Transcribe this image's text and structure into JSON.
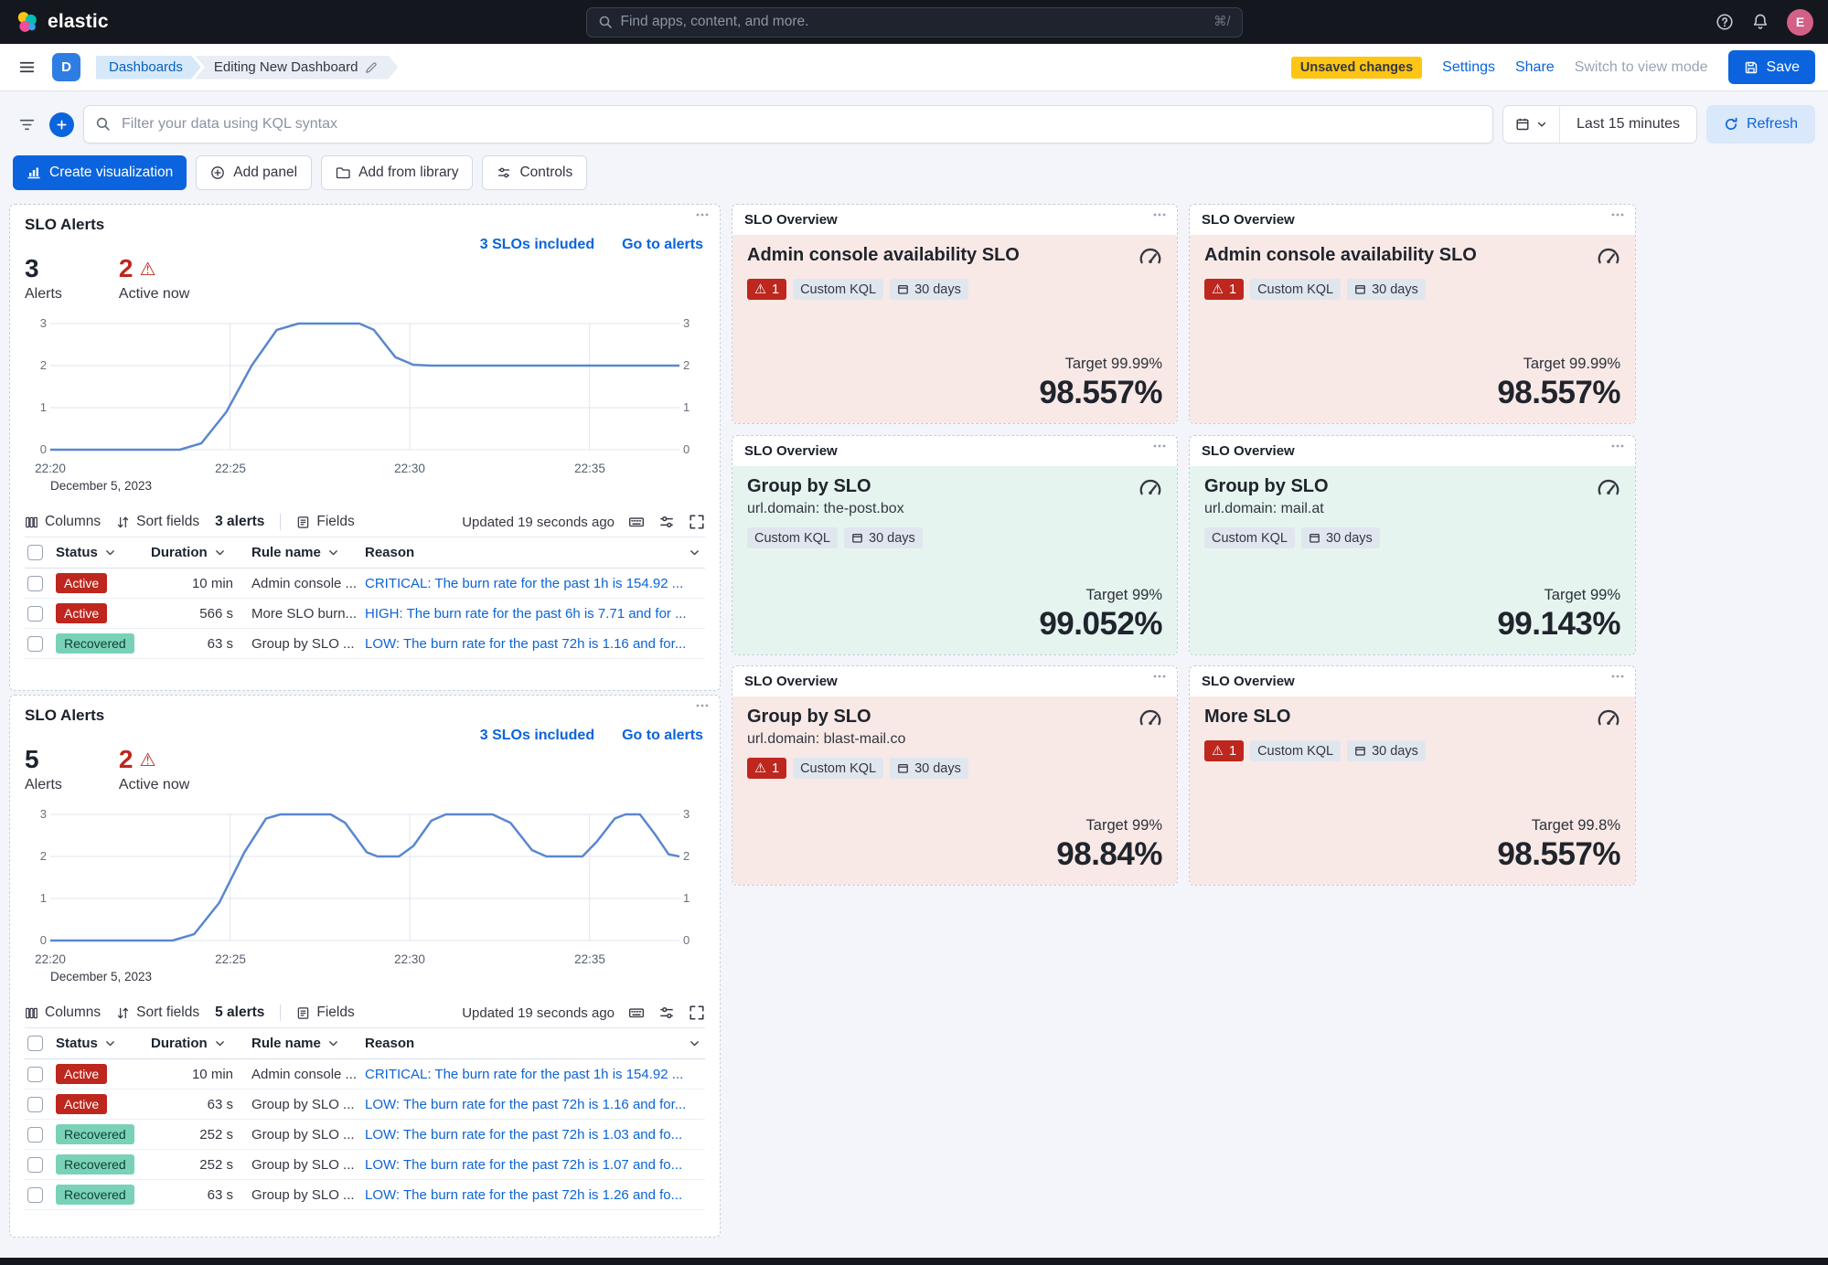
{
  "colors": {
    "primary": "#0b64dd",
    "danger": "#bd271e",
    "warning_badge": "#fec514",
    "success_badge": "#79d2b8",
    "tint_danger": "#f8e9e6",
    "tint_success": "#e5f4ef",
    "chart_line": "#5a87cf"
  },
  "icons": {
    "warning": "⚠"
  },
  "header": {
    "brand": "elastic",
    "search_placeholder": "Find apps, content, and more.",
    "search_shortcut": "⌘/",
    "avatar_initial": "E"
  },
  "toolbar": {
    "space_initial": "D",
    "breadcrumb_root": "Dashboards",
    "breadcrumb_current": "Editing New Dashboard",
    "unsaved_badge": "Unsaved changes",
    "settings_label": "Settings",
    "share_label": "Share",
    "view_mode_label": "Switch to view mode",
    "save_label": "Save"
  },
  "query_bar": {
    "kql_placeholder": "Filter your data using KQL syntax",
    "time_range": "Last 15 minutes",
    "refresh_label": "Refresh"
  },
  "edit_actions": {
    "create_visualization": "Create visualization",
    "add_panel": "Add panel",
    "add_from_library": "Add from library",
    "controls": "Controls"
  },
  "alerts_panels": [
    {
      "title": "SLO Alerts",
      "slos_included_link": "3 SLOs included",
      "go_to_alerts_link": "Go to alerts",
      "stats": [
        {
          "value": "3",
          "label": "Alerts"
        },
        {
          "value": "2",
          "label": "Active now"
        }
      ],
      "chart": {
        "type": "line",
        "line_color": "#5a87cf",
        "x_axis": {
          "t_max": 17.5,
          "ticks": [
            {
              "label": "22:20",
              "sub": "December 5, 2023",
              "t": 0
            },
            {
              "label": "22:25",
              "t": 5
            },
            {
              "label": "22:30",
              "t": 10
            },
            {
              "label": "22:35",
              "t": 15
            }
          ]
        },
        "y_axis": {
          "min": 0,
          "max": 3,
          "ticks": [
            0,
            1,
            2,
            3
          ]
        },
        "series": [
          {
            "name": "alerts",
            "points": [
              [
                0,
                0
              ],
              [
                3.6,
                0
              ],
              [
                4.2,
                0.15
              ],
              [
                4.9,
                0.9
              ],
              [
                5.6,
                2.0
              ],
              [
                6.3,
                2.85
              ],
              [
                6.9,
                3
              ],
              [
                8.6,
                3
              ],
              [
                9.0,
                2.85
              ],
              [
                9.6,
                2.2
              ],
              [
                10.1,
                2.02
              ],
              [
                10.6,
                2
              ],
              [
                17.5,
                2
              ]
            ]
          }
        ]
      },
      "grid_toolbar": {
        "columns": "Columns",
        "sort_fields": "Sort fields",
        "alert_count": "3 alerts",
        "fields": "Fields",
        "updated": "Updated 19 seconds ago"
      },
      "table": {
        "headers": [
          "Status",
          "Duration",
          "Rule name",
          "Reason"
        ],
        "rows": [
          {
            "status": "Active",
            "status_type": "active",
            "duration": "10 min",
            "rule_name": "Admin console ...",
            "reason": "CRITICAL: The burn rate for the past 1h is 154.92 ..."
          },
          {
            "status": "Active",
            "status_type": "active",
            "duration": "566 s",
            "rule_name": "More SLO burn...",
            "reason": "HIGH: The burn rate for the past 6h is 7.71 and for ..."
          },
          {
            "status": "Recovered",
            "status_type": "recovered",
            "duration": "63 s",
            "rule_name": "Group by SLO ...",
            "reason": "LOW: The burn rate for the past 72h is 1.16 and for..."
          }
        ]
      }
    },
    {
      "title": "SLO Alerts",
      "slos_included_link": "3 SLOs included",
      "go_to_alerts_link": "Go to alerts",
      "stats": [
        {
          "value": "5",
          "label": "Alerts"
        },
        {
          "value": "2",
          "label": "Active now"
        }
      ],
      "chart": {
        "type": "line",
        "line_color": "#5a87cf",
        "x_axis": {
          "t_max": 17.5,
          "ticks": [
            {
              "label": "22:20",
              "sub": "December 5, 2023",
              "t": 0
            },
            {
              "label": "22:25",
              "t": 5
            },
            {
              "label": "22:30",
              "t": 10
            },
            {
              "label": "22:35",
              "t": 15
            }
          ]
        },
        "y_axis": {
          "min": 0,
          "max": 3,
          "ticks": [
            0,
            1,
            2,
            3
          ]
        },
        "series": [
          {
            "name": "alerts",
            "points": [
              [
                0,
                0
              ],
              [
                3.4,
                0
              ],
              [
                4.0,
                0.15
              ],
              [
                4.7,
                0.9
              ],
              [
                5.4,
                2.1
              ],
              [
                6.0,
                2.9
              ],
              [
                6.4,
                3
              ],
              [
                7.8,
                3
              ],
              [
                8.2,
                2.8
              ],
              [
                8.8,
                2.1
              ],
              [
                9.1,
                2
              ],
              [
                9.7,
                2
              ],
              [
                10.1,
                2.25
              ],
              [
                10.6,
                2.85
              ],
              [
                11.0,
                3
              ],
              [
                12.3,
                3
              ],
              [
                12.8,
                2.8
              ],
              [
                13.4,
                2.15
              ],
              [
                13.8,
                2
              ],
              [
                14.8,
                2
              ],
              [
                15.2,
                2.35
              ],
              [
                15.7,
                2.9
              ],
              [
                16.0,
                3
              ],
              [
                16.4,
                3
              ],
              [
                16.8,
                2.55
              ],
              [
                17.2,
                2.05
              ],
              [
                17.5,
                2
              ]
            ]
          }
        ]
      },
      "grid_toolbar": {
        "columns": "Columns",
        "sort_fields": "Sort fields",
        "alert_count": "5 alerts",
        "fields": "Fields",
        "updated": "Updated 19 seconds ago"
      },
      "table": {
        "headers": [
          "Status",
          "Duration",
          "Rule name",
          "Reason"
        ],
        "rows": [
          {
            "status": "Active",
            "status_type": "active",
            "duration": "10 min",
            "rule_name": "Admin console ...",
            "reason": "CRITICAL: The burn rate for the past 1h is 154.92 ..."
          },
          {
            "status": "Active",
            "status_type": "active",
            "duration": "63 s",
            "rule_name": "Group by SLO ...",
            "reason": "LOW: The burn rate for the past 72h is 1.16 and for..."
          },
          {
            "status": "Recovered",
            "status_type": "recovered",
            "duration": "252 s",
            "rule_name": "Group by SLO ...",
            "reason": "LOW: The burn rate for the past 72h is 1.03 and fo..."
          },
          {
            "status": "Recovered",
            "status_type": "recovered",
            "duration": "252 s",
            "rule_name": "Group by SLO ...",
            "reason": "LOW: The burn rate for the past 72h is 1.07 and fo..."
          },
          {
            "status": "Recovered",
            "status_type": "recovered",
            "duration": "63 s",
            "rule_name": "Group by SLO ...",
            "reason": "LOW: The burn rate for the past 72h is 1.26 and fo..."
          }
        ]
      }
    }
  ],
  "overview_panels": [
    {
      "header": "SLO Overview",
      "title": "Admin console availability SLO",
      "alert_count": "1",
      "badges": [
        "Custom KQL",
        "30 days"
      ],
      "target": "Target 99.99%",
      "value": "98.557%",
      "status": "danger"
    },
    {
      "header": "SLO Overview",
      "title": "Admin console availability SLO",
      "alert_count": "1",
      "badges": [
        "Custom KQL",
        "30 days"
      ],
      "target": "Target 99.99%",
      "value": "98.557%",
      "status": "danger"
    },
    {
      "header": "SLO Overview",
      "title": "Group by SLO",
      "subtitle": "url.domain: the-post.box",
      "badges": [
        "Custom KQL",
        "30 days"
      ],
      "target": "Target 99%",
      "value": "99.052%",
      "status": "success"
    },
    {
      "header": "SLO Overview",
      "title": "Group by SLO",
      "subtitle": "url.domain: mail.at",
      "badges": [
        "Custom KQL",
        "30 days"
      ],
      "target": "Target 99%",
      "value": "99.143%",
      "status": "success"
    },
    {
      "header": "SLO Overview",
      "title": "Group by SLO",
      "subtitle": "url.domain: blast-mail.co",
      "alert_count": "1",
      "badges": [
        "Custom KQL",
        "30 days"
      ],
      "target": "Target 99%",
      "value": "98.84%",
      "status": "danger"
    },
    {
      "header": "SLO Overview",
      "title": "More SLO",
      "alert_count": "1",
      "badges": [
        "Custom KQL",
        "30 days"
      ],
      "target": "Target 99.8%",
      "value": "98.557%",
      "status": "danger"
    }
  ]
}
